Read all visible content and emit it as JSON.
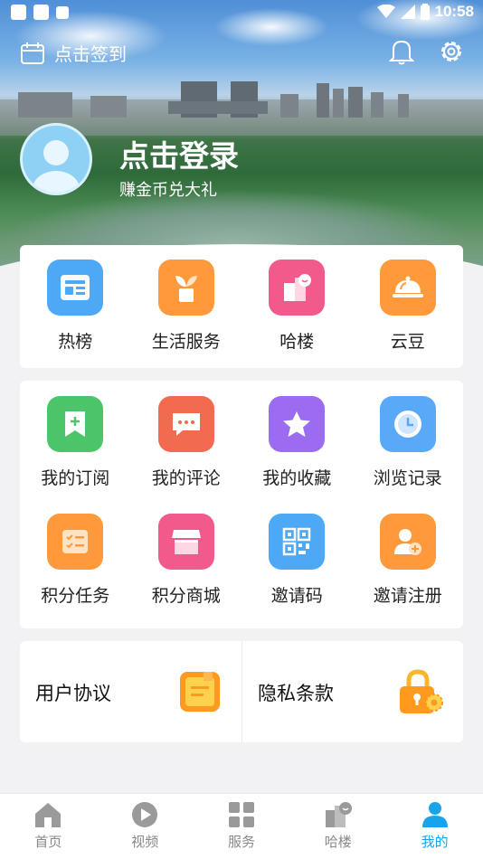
{
  "status_bar": {
    "time": "10:58"
  },
  "header": {
    "checkin_label": "点击签到",
    "login_title": "点击登录",
    "login_subtitle": "赚金币兑大礼"
  },
  "top_grid": [
    {
      "label": "热榜",
      "icon": "hot-list-icon",
      "color": "#4da9f5"
    },
    {
      "label": "生活服务",
      "icon": "plant-icon",
      "color": "#ff9a3c"
    },
    {
      "label": "哈楼",
      "icon": "building-icon",
      "color": "#f25a8b"
    },
    {
      "label": "云豆",
      "icon": "cloche-icon",
      "color": "#ff9a3c"
    }
  ],
  "features_row1": [
    {
      "label": "我的订阅",
      "icon": "bookmark-add-icon",
      "color": "#4cc46a"
    },
    {
      "label": "我的评论",
      "icon": "comment-icon",
      "color": "#f26a4f"
    },
    {
      "label": "我的收藏",
      "icon": "star-icon",
      "color": "#9b6cf0"
    },
    {
      "label": "浏览记录",
      "icon": "clock-icon",
      "color": "#5aa8f8"
    }
  ],
  "features_row2": [
    {
      "label": "积分任务",
      "icon": "task-list-icon",
      "color": "#ff9a3c"
    },
    {
      "label": "积分商城",
      "icon": "store-icon",
      "color": "#f25a8b"
    },
    {
      "label": "邀请码",
      "icon": "qr-code-icon",
      "color": "#4da9f5"
    },
    {
      "label": "邀请注册",
      "icon": "add-user-icon",
      "color": "#ff9a3c"
    }
  ],
  "links": [
    {
      "label": "用户协议",
      "icon": "document-icon"
    },
    {
      "label": "隐私条款",
      "icon": "lock-icon"
    }
  ],
  "bottom_nav": [
    {
      "label": "首页",
      "icon": "home-icon"
    },
    {
      "label": "视频",
      "icon": "play-icon"
    },
    {
      "label": "服务",
      "icon": "grid-icon"
    },
    {
      "label": "哈楼",
      "icon": "building-icon"
    },
    {
      "label": "我的",
      "icon": "person-icon",
      "active": true
    }
  ]
}
